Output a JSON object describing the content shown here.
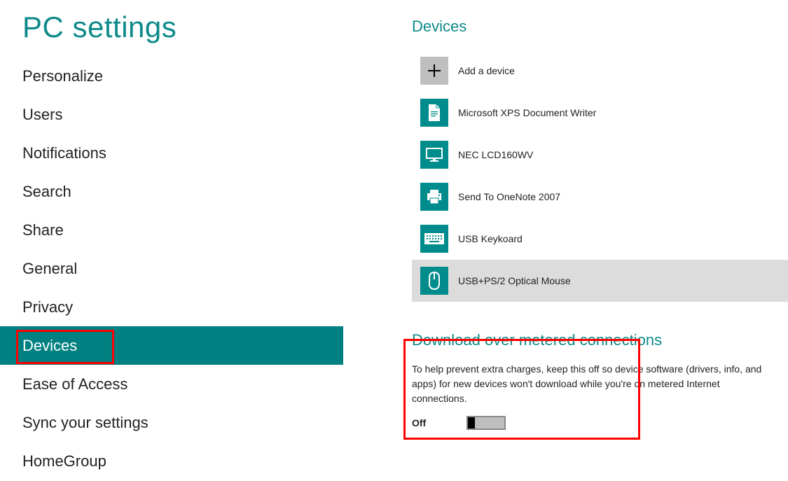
{
  "page_title": "PC settings",
  "sidebar": {
    "items": [
      {
        "label": "Personalize"
      },
      {
        "label": "Users"
      },
      {
        "label": "Notifications"
      },
      {
        "label": "Search"
      },
      {
        "label": "Share"
      },
      {
        "label": "General"
      },
      {
        "label": "Privacy"
      },
      {
        "label": "Devices"
      },
      {
        "label": "Ease of Access"
      },
      {
        "label": "Sync your settings"
      },
      {
        "label": "HomeGroup"
      }
    ],
    "active_index": 7
  },
  "devices_section": {
    "title": "Devices",
    "items": [
      {
        "label": "Add a device",
        "icon": "plus"
      },
      {
        "label": "Microsoft XPS Document Writer",
        "icon": "document"
      },
      {
        "label": "NEC LCD160WV",
        "icon": "monitor"
      },
      {
        "label": "Send To OneNote 2007",
        "icon": "printer"
      },
      {
        "label": "USB Keykoard",
        "icon": "keyboard"
      },
      {
        "label": "USB+PS/2 Optical Mouse",
        "icon": "mouse"
      }
    ],
    "selected_index": 5
  },
  "metered": {
    "title": "Download over metered connections",
    "description": "To help prevent extra charges, keep this off so device software (drivers, info, and apps) for new devices won't download while you're on metered Internet connections.",
    "toggle_label": "Off",
    "toggle_state": "off"
  },
  "colors": {
    "accent": "#008080",
    "accent_text": "#0e8a8a",
    "highlight_box": "#ff0000"
  }
}
